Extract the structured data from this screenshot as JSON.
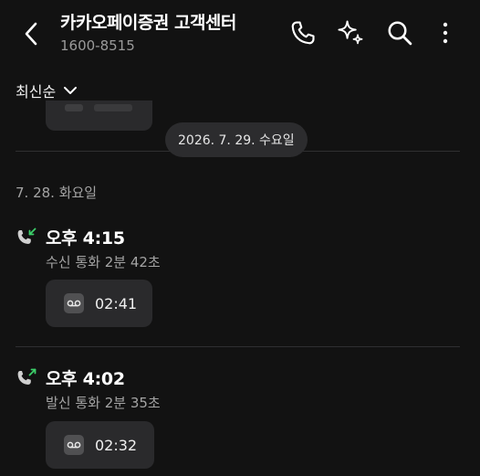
{
  "header": {
    "title": "카카오페이증권 고객센터",
    "phone_number": "1600-8515",
    "icons": [
      "back-arrow-icon",
      "phone-icon",
      "sparkle-icon",
      "search-icon",
      "more-vertical-icon"
    ]
  },
  "sort": {
    "label": "최신순",
    "icon": "chevron-down-icon"
  },
  "date_pill": "2026. 7. 29. 수요일",
  "day_label": "7. 28. 화요일",
  "calls": [
    {
      "type": "incoming",
      "icon": "incoming-call-icon",
      "time": "오후 4:15",
      "desc": "수신 통화 2분 42초",
      "recording": "02:41"
    },
    {
      "type": "outgoing",
      "icon": "outgoing-call-icon",
      "time": "오후 4:02",
      "desc": "발신 통화 2분 35초",
      "recording": "02:32"
    }
  ],
  "colors": {
    "background": "#121212",
    "card": "#2a2a2c",
    "pill": "#2c2c2e",
    "arrow_green": "#3ccf6a",
    "muted_text": "#a4a4a4"
  }
}
